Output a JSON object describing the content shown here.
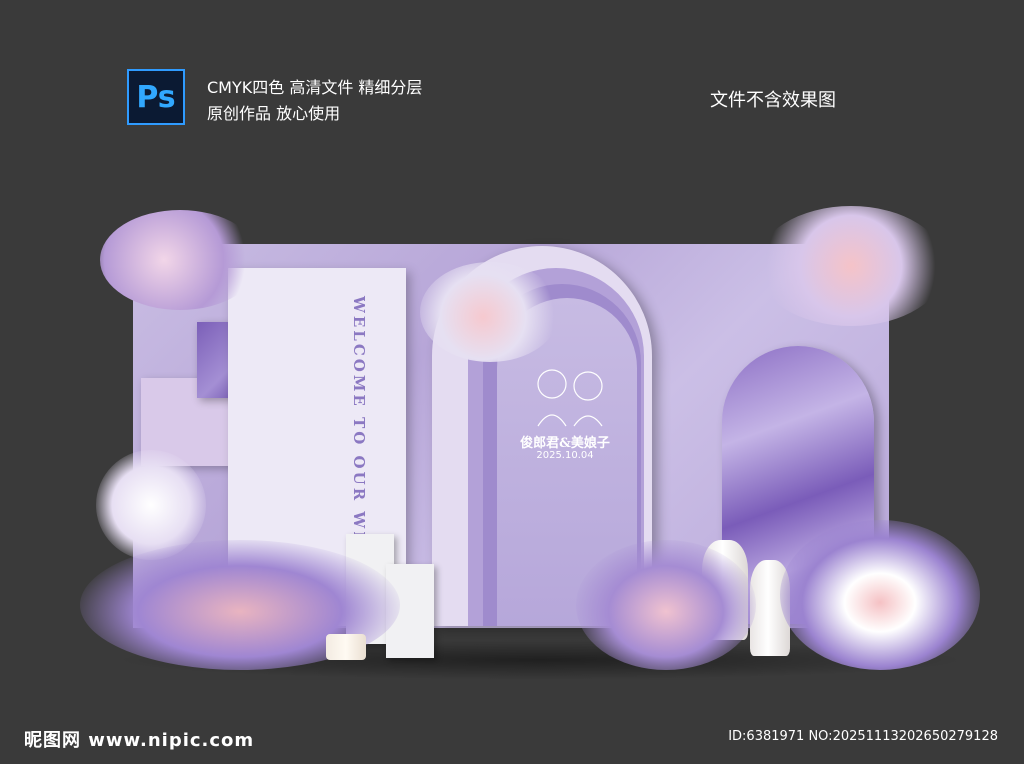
{
  "header": {
    "ps_label": "Ps",
    "line1": "CMYK四色 高清文件 精细分层",
    "line2": "原创作品 放心使用",
    "note": "文件不含效果图"
  },
  "scene": {
    "welcome_text": "WELCOME TO OUR WEDDI",
    "couple_names": "俊郎君&美娘子",
    "couple_date": "2025.10.04"
  },
  "footer": {
    "site": "昵图网 www.nipic.com",
    "id_text": "ID:6381971 NO:20251113202650279128"
  },
  "colors": {
    "background": "#3a3a3a",
    "lavender": "#b7a6d8",
    "purple": "#7b5fb8",
    "accent": "#31a8ff"
  }
}
